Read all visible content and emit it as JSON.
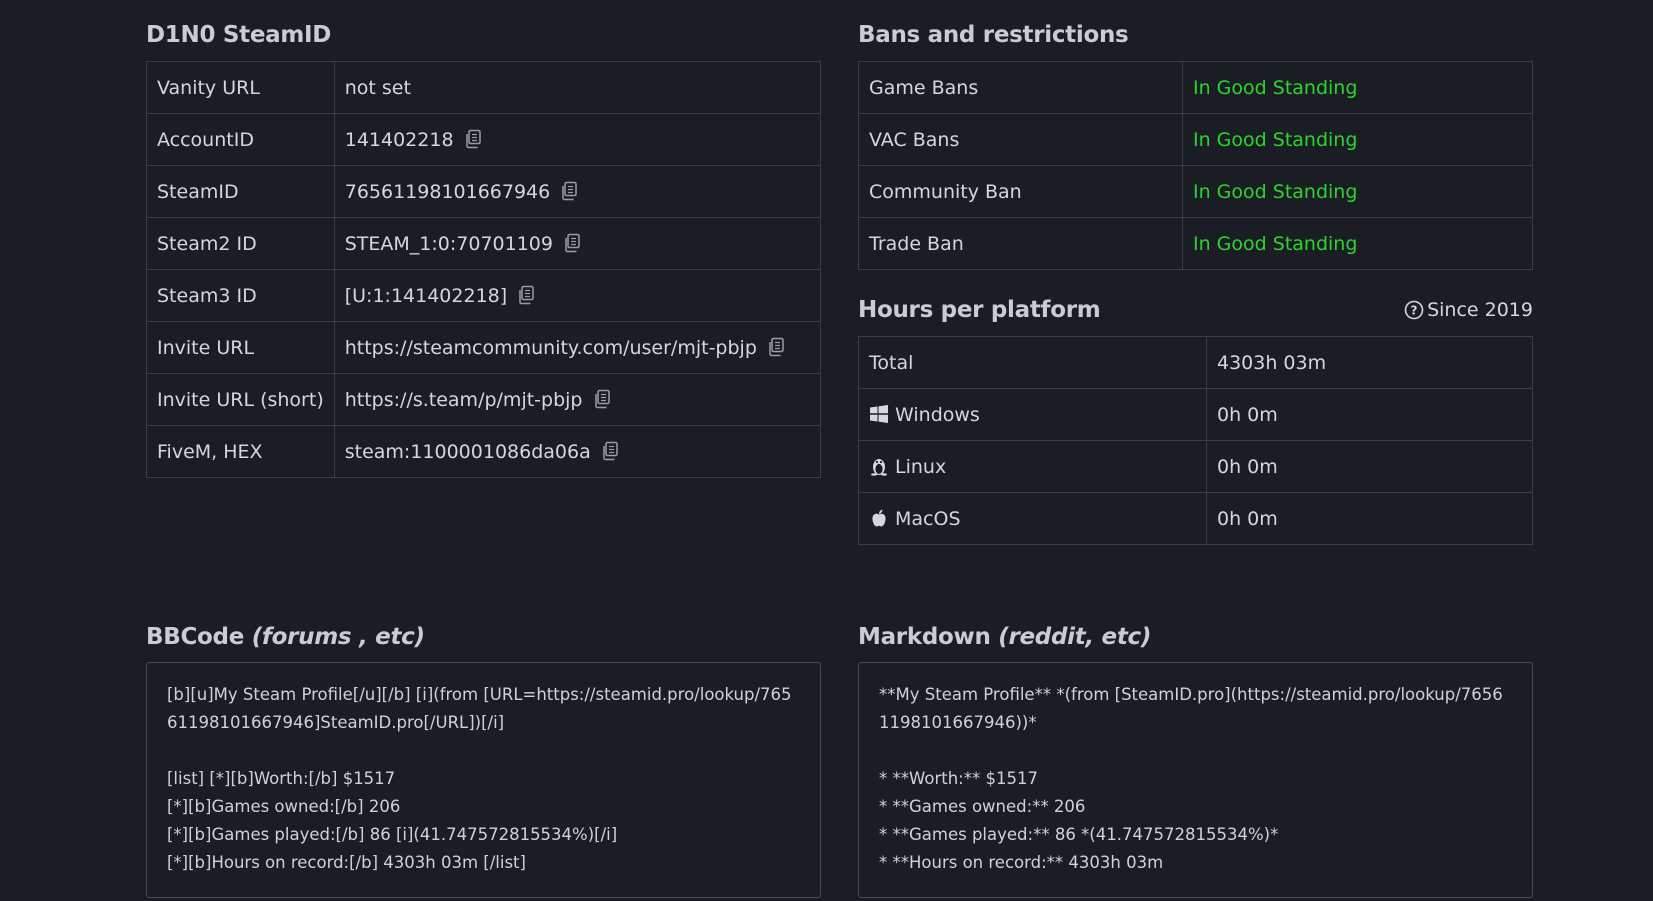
{
  "steamid_section": {
    "title": "D1N0 SteamID",
    "rows": [
      {
        "label": "Vanity URL",
        "value": "not set",
        "copy": false
      },
      {
        "label": "AccountID",
        "value": "141402218",
        "copy": true
      },
      {
        "label": "SteamID",
        "value": "76561198101667946",
        "copy": true
      },
      {
        "label": "Steam2 ID",
        "value": "STEAM_1:0:70701109",
        "copy": true
      },
      {
        "label": "Steam3 ID",
        "value": "[U:1:141402218]",
        "copy": true
      },
      {
        "label": "Invite URL",
        "value": "https://steamcommunity.com/user/mjt-pbjp",
        "copy": true
      },
      {
        "label": "Invite URL (short)",
        "value": "https://s.team/p/mjt-pbjp",
        "copy": true
      },
      {
        "label": "FiveM, HEX",
        "value": "steam:1100001086da06a",
        "copy": true
      }
    ]
  },
  "bans_section": {
    "title": "Bans and restrictions",
    "rows": [
      {
        "label": "Game Bans",
        "value": "In Good Standing"
      },
      {
        "label": "VAC Bans",
        "value": "In Good Standing"
      },
      {
        "label": "Community Ban",
        "value": "In Good Standing"
      },
      {
        "label": "Trade Ban",
        "value": "In Good Standing"
      }
    ]
  },
  "hours_section": {
    "title": "Hours per platform",
    "since": "Since 2019",
    "rows": [
      {
        "label": "Total",
        "value": "4303h 03m",
        "icon": ""
      },
      {
        "label": "Windows",
        "value": "0h 0m",
        "icon": "windows-icon"
      },
      {
        "label": "Linux",
        "value": "0h 0m",
        "icon": "linux-icon"
      },
      {
        "label": "MacOS",
        "value": "0h 0m",
        "icon": "apple-icon"
      }
    ]
  },
  "bbcode_section": {
    "title": "BBCode ",
    "title_italic": "(forums , etc)",
    "lines": [
      "[b][u]My Steam Profile[/u][/b] [i](from [URL=https://steamid.pro/lookup/76561198101667946]SteamID.pro[/URL])[/i]",
      "",
      "[list] [*][b]Worth:[/b] $1517",
      "[*][b]Games owned:[/b] 206",
      "[*][b]Games played:[/b] 86 [i](41.747572815534%)[/i]",
      "[*][b]Hours on record:[/b] 4303h 03m [/list]"
    ]
  },
  "markdown_section": {
    "title": "Markdown ",
    "title_italic": "(reddit, etc)",
    "lines": [
      "**My Steam Profile** *(from [SteamID.pro](https://steamid.pro/lookup/76561198101667946))*",
      "",
      "* **Worth:** $1517",
      "* **Games owned:** 206",
      "* **Games played:** 86 *(41.747572815534%)*",
      "* **Hours on record:** 4303h 03m"
    ]
  },
  "colors": {
    "background": "#1b1d25",
    "good_standing": "#2bd52b",
    "border": "#3a3d46"
  }
}
